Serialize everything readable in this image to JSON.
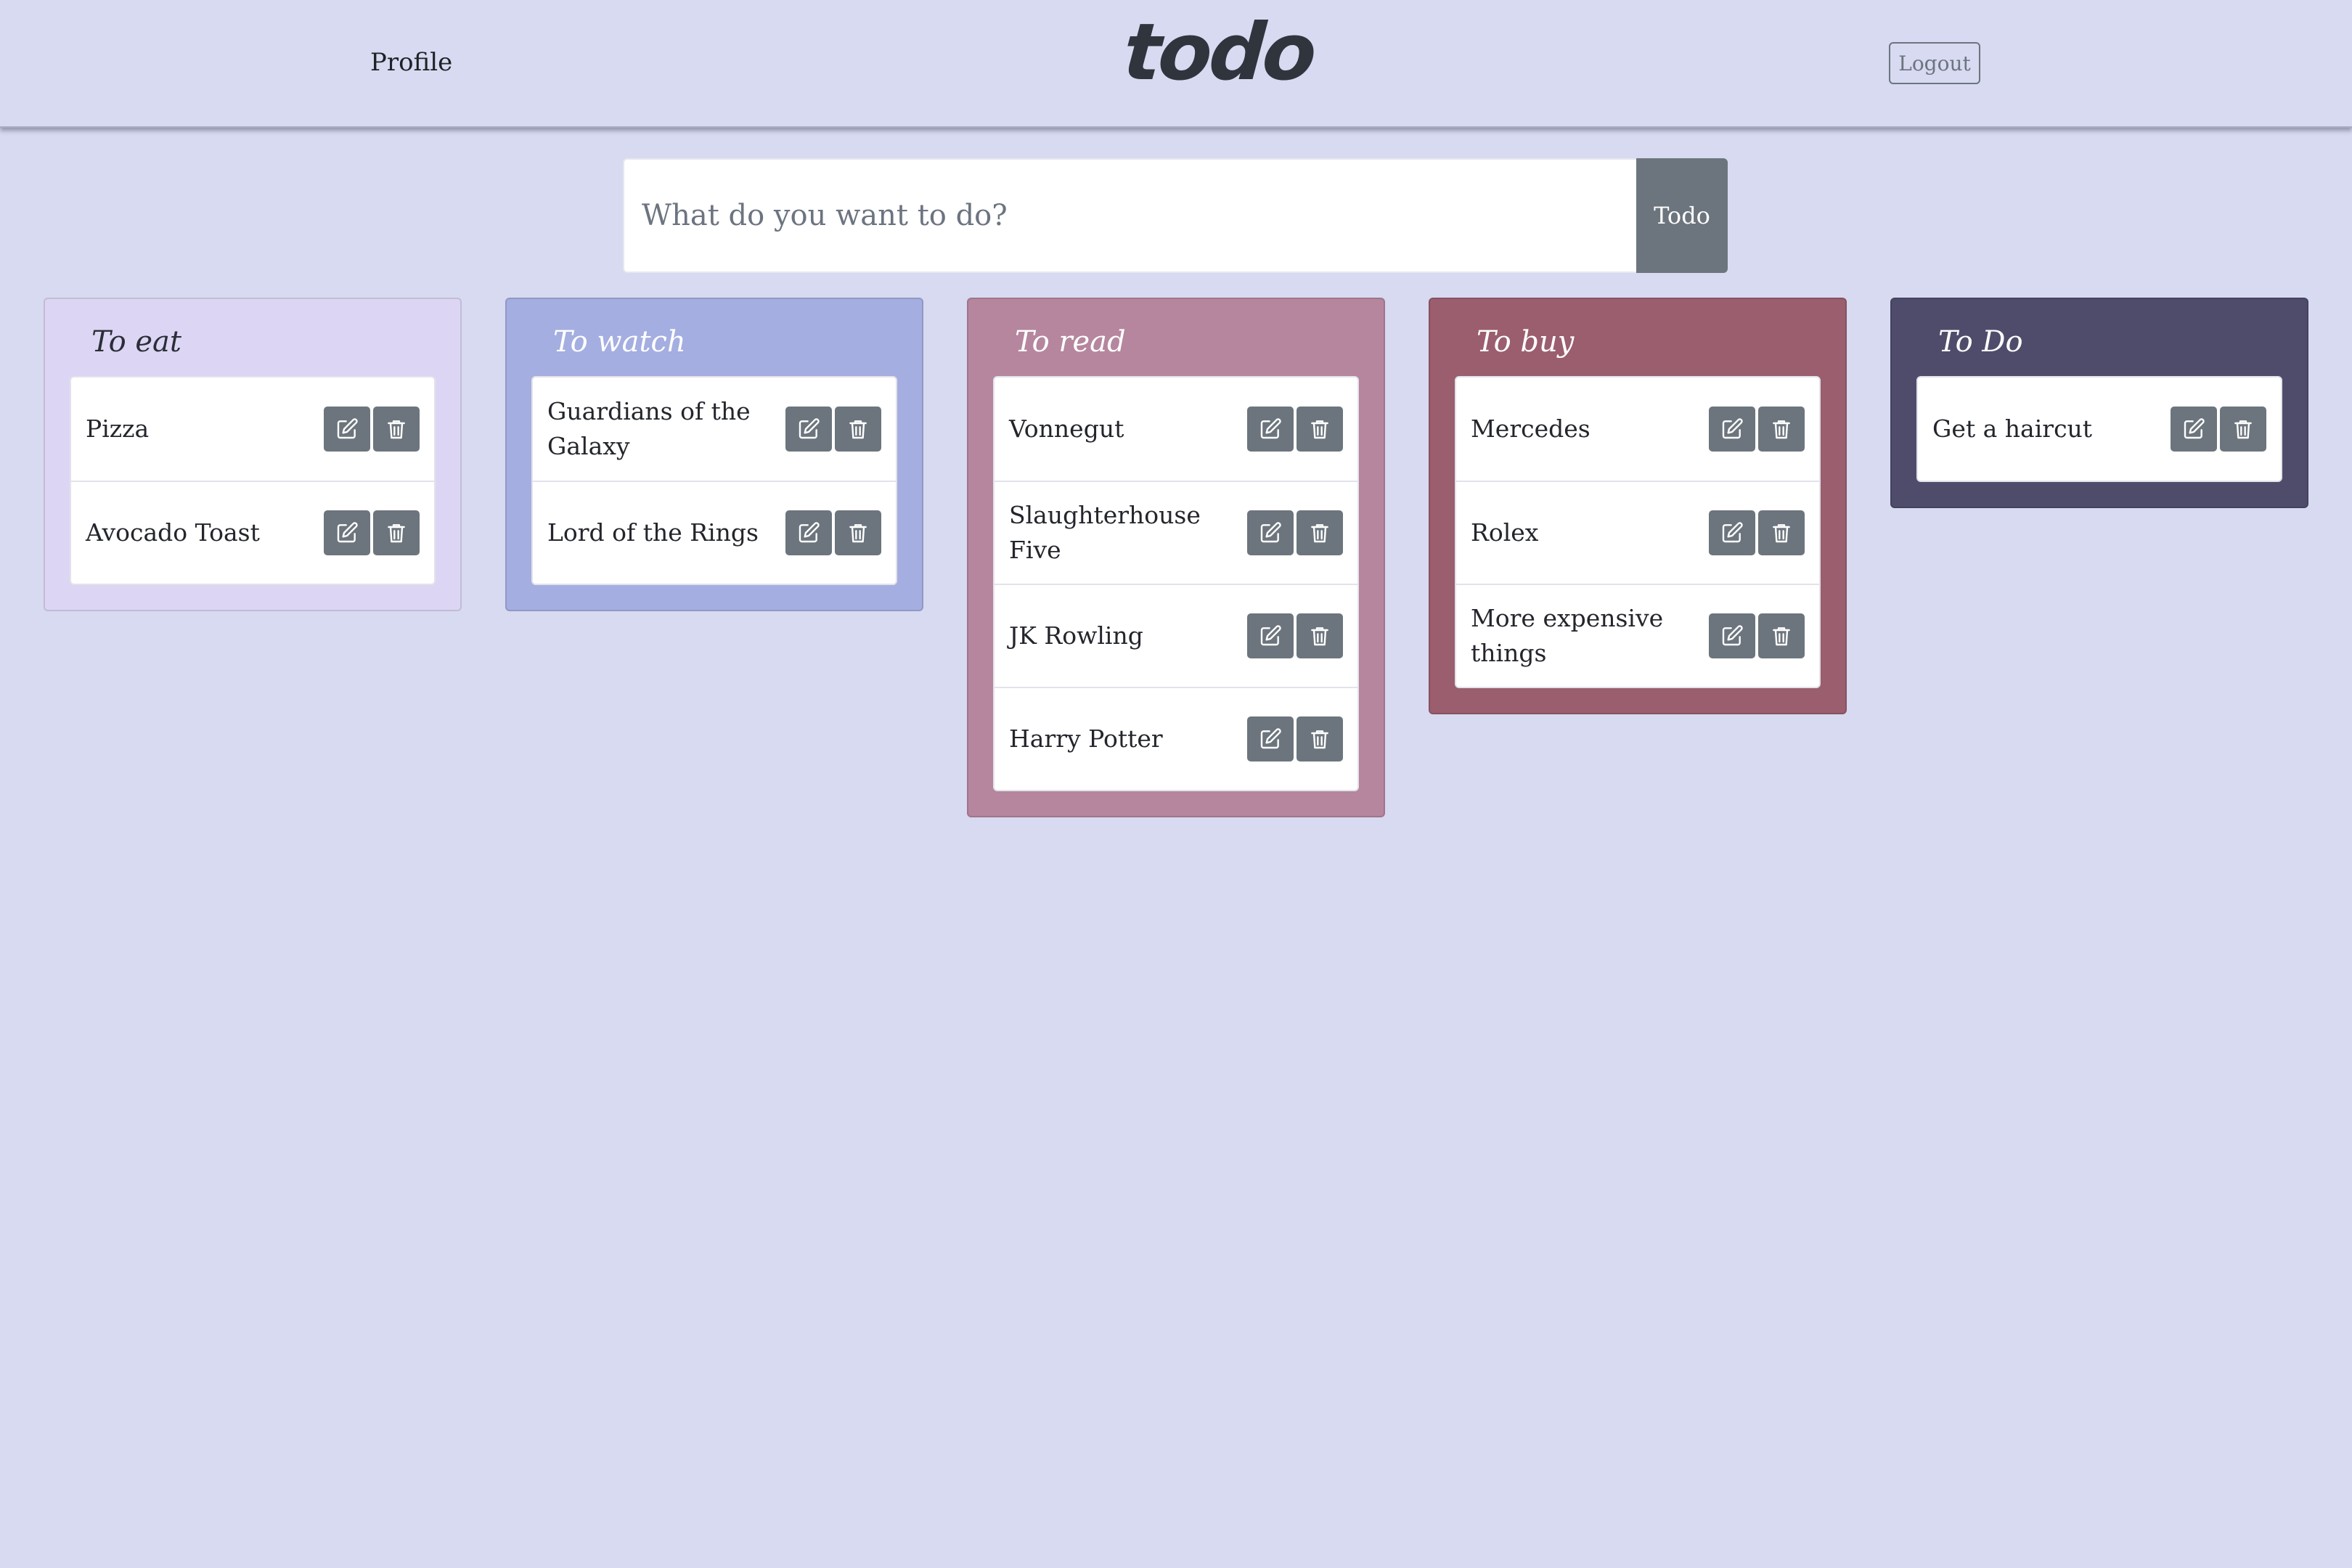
{
  "header": {
    "profile_label": "Profile",
    "logo_text": "todo",
    "logout_label": "Logout"
  },
  "add_bar": {
    "placeholder": "What do you want to do?",
    "value": "",
    "button_label": "Todo"
  },
  "icons": {
    "edit": "edit-icon",
    "delete": "trash-icon"
  },
  "lists": [
    {
      "title": "To eat",
      "bg_color": "#dcd6f4",
      "title_color": "#2b2e38",
      "items": [
        "Pizza",
        "Avocado Toast"
      ]
    },
    {
      "title": "To watch",
      "bg_color": "#a4aee0",
      "title_color": "#ffffff",
      "items": [
        "Guardians of the Galaxy",
        "Lord of the Rings"
      ]
    },
    {
      "title": "To read",
      "bg_color": "#b5869e",
      "title_color": "#ffffff",
      "items": [
        "Vonnegut",
        "Slaughterhouse Five",
        "JK Rowling",
        "Harry Potter"
      ]
    },
    {
      "title": "To buy",
      "bg_color": "#9a5e6e",
      "title_color": "#ffffff",
      "items": [
        "Mercedes",
        "Rolex",
        "More expensive things"
      ]
    },
    {
      "title": "To Do",
      "bg_color": "#4f4c6b",
      "title_color": "#ffffff",
      "items": [
        "Get a haircut"
      ]
    }
  ]
}
